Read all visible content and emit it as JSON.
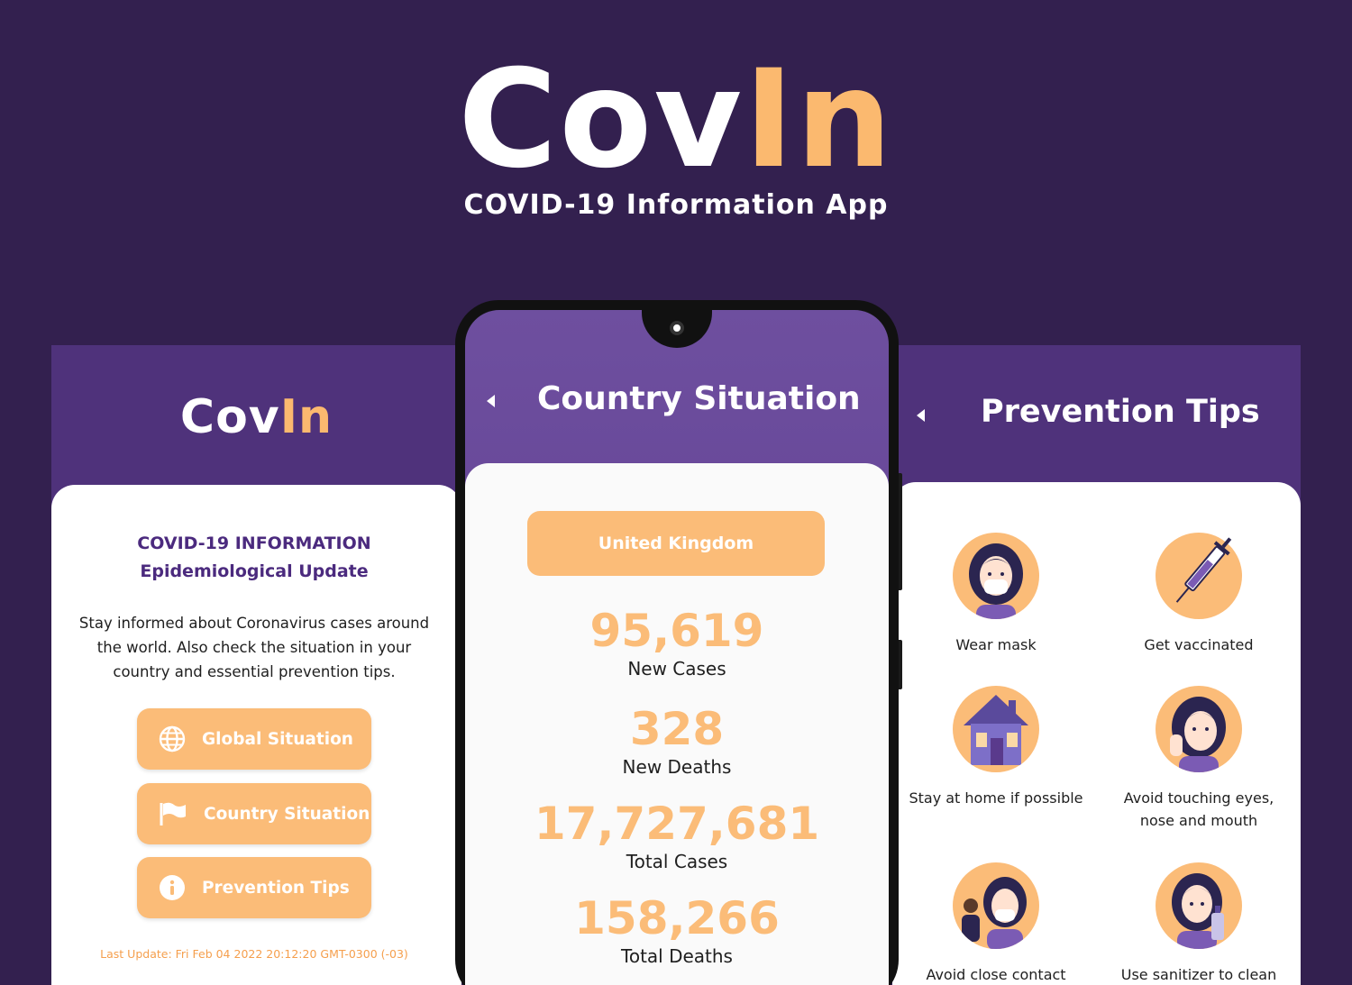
{
  "hero": {
    "logo_part1": "Cov",
    "logo_part2": "In",
    "subtitle": "COVID-19 Information App"
  },
  "colors": {
    "background": "#33204f",
    "panel_purple": "#4f327b",
    "accent_orange": "#fbbc78",
    "title_purple": "#4b2a7e"
  },
  "home_screen": {
    "logo_part1": "Cov",
    "logo_part2": "In",
    "title_line1": "COVID-19 INFORMATION",
    "title_line2": "Epidemiological Update",
    "description": "Stay informed about Coronavirus cases around the world. Also check the situation in your country and essential prevention tips.",
    "buttons": [
      {
        "label": "Global Situation",
        "icon": "globe-icon"
      },
      {
        "label": "Country Situation",
        "icon": "flag-icon"
      },
      {
        "label": "Prevention Tips",
        "icon": "info-icon"
      }
    ],
    "last_update": "Last Update: Fri Feb 04 2022 20:12:20 GMT-0300 (-03)"
  },
  "country_screen": {
    "title": "Country Situation",
    "back_icon": "back-arrow-icon",
    "country": "United Kingdom",
    "stats": [
      {
        "value": "95,619",
        "label": "New Cases"
      },
      {
        "value": "328",
        "label": "New Deaths"
      },
      {
        "value": "17,727,681",
        "label": "Total Cases"
      },
      {
        "value": "158,266",
        "label": "Total Deaths"
      }
    ]
  },
  "tips_screen": {
    "title": "Prevention Tips",
    "back_icon": "back-arrow-icon",
    "tips": [
      {
        "label": "Wear mask",
        "icon": "mask-woman-icon"
      },
      {
        "label": "Get vaccinated",
        "icon": "syringe-icon"
      },
      {
        "label": "Stay at home if possible",
        "icon": "house-icon"
      },
      {
        "label": "Avoid touching eyes, nose and mouth",
        "icon": "no-touch-face-icon"
      },
      {
        "label": "Avoid close contact",
        "icon": "distancing-icon"
      },
      {
        "label": "Use sanitizer to clean",
        "icon": "sanitizer-icon"
      }
    ]
  }
}
